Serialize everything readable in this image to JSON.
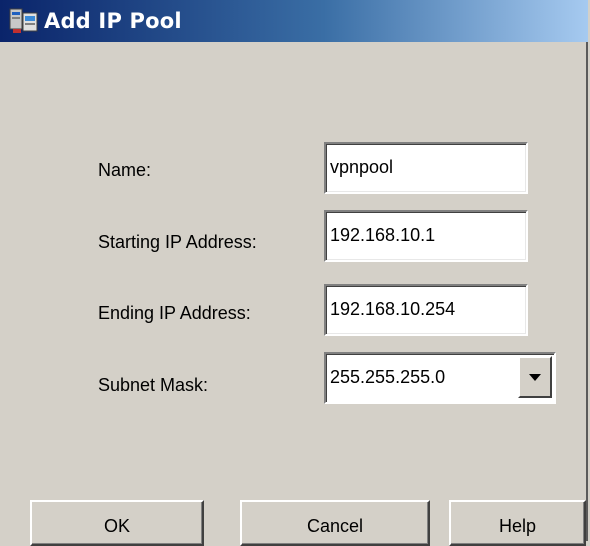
{
  "window": {
    "title": "Add IP Pool",
    "icon": "ip-pool-icon"
  },
  "form": {
    "name": {
      "label": "Name:",
      "value": "vpnpool"
    },
    "start_ip": {
      "label": "Starting IP Address:",
      "value": "192.168.10.1"
    },
    "end_ip": {
      "label": "Ending IP Address:",
      "value": "192.168.10.254"
    },
    "subnet_mask": {
      "label": "Subnet Mask:",
      "value": "255.255.255.0"
    }
  },
  "buttons": {
    "ok": "OK",
    "cancel": "Cancel",
    "help": "Help"
  },
  "colors": {
    "dialog_bg": "#d4d0c8",
    "titlebar_start": "#0a246a",
    "titlebar_end": "#a6caf0"
  }
}
